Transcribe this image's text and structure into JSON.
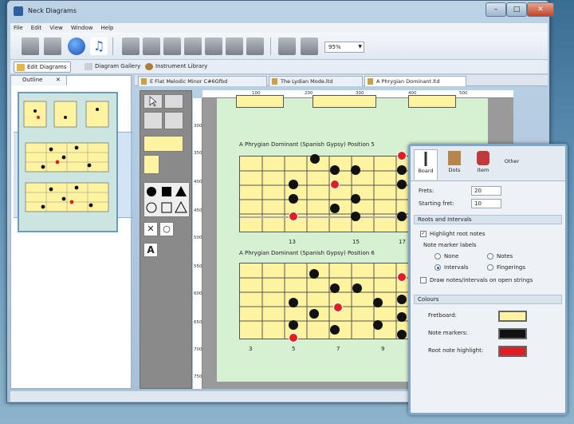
{
  "window": {
    "title": "Neck Diagrams",
    "min": "–",
    "max": "□",
    "close": "✕"
  },
  "menu": [
    "File",
    "Edit",
    "View",
    "Window",
    "Help"
  ],
  "toolbar": {
    "zoom": "95%"
  },
  "modes": {
    "edit": "Edit Diagrams",
    "gallery": "Diagram Gallery",
    "library": "Instrument Library"
  },
  "outline": {
    "tab": "Outline"
  },
  "editor_tabs": [
    "E Flat Melodic Minor C#6Gfbd",
    "The Lydian Mode.ltd",
    "A Phrygian Dominant.ltd"
  ],
  "ruler": {
    "h": [
      "100",
      "200",
      "300",
      "400",
      "500"
    ],
    "v": [
      "300",
      "350",
      "400",
      "450",
      "500",
      "550",
      "600",
      "650",
      "700",
      "750"
    ]
  },
  "diagrams": [
    {
      "title": "A Phrygian Dominant (Spanish Gypsy) Position 5",
      "frets": [
        "13",
        "15",
        "17"
      ]
    },
    {
      "title": "A Phrygian Dominant (Spanish Gypsy) Position 6",
      "frets": [
        "3",
        "5",
        "7",
        "9"
      ]
    }
  ],
  "props": {
    "tabs": [
      "Board",
      "Dots",
      "Item",
      "Other"
    ],
    "frets_label": "Frets:",
    "frets_value": "20",
    "starting_fret_label": "Starting fret:",
    "starting_fret_value": "10",
    "section_roots": "Roots and Intervals",
    "highlight_root": "Highlight root notes",
    "note_marker_labels": "Note marker labels",
    "opt_none": "None",
    "opt_notes": "Notes",
    "opt_intervals": "Intervals",
    "opt_fingerings": "Fingerings",
    "draw_open": "Draw notes/intervals on open strings",
    "section_colours": "Colours",
    "fretboard": "Fretboard:",
    "note_markers": "Note markers:",
    "root_highlight": "Root note highlight:"
  },
  "colors": {
    "fretboard": "#fdf3a0",
    "note_marker": "#111111",
    "root_highlight": "#e02020",
    "page_bg": "#d6f0d2"
  }
}
